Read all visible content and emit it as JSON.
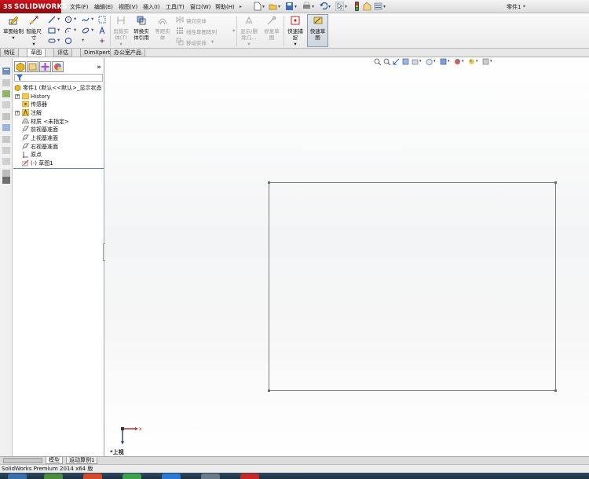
{
  "app": {
    "logo": "SOLIDWORKS",
    "document_title": "零件1 *"
  },
  "menu": {
    "items": [
      "文件(F)",
      "编辑(E)",
      "视图(V)",
      "插入(I)",
      "工具(T)",
      "窗口(W)",
      "帮助(H)"
    ]
  },
  "command_manager": {
    "sketch": "草图绘制",
    "smart_dim_1": "智能尺",
    "smart_dim_2": "寸",
    "trim_1": "剪裁实",
    "trim_2": "体(T)",
    "convert_1": "转换实",
    "convert_2": "体引用",
    "offset_1": "等距实",
    "offset_2": "体",
    "mirror": "镜向实体",
    "linear_pattern": "线性草图阵列",
    "move": "移动实体",
    "display_delete_1": "显示/删",
    "display_delete_2": "除几...",
    "repair_1": "修复草",
    "repair_2": "图",
    "quick_snap_1": "快速捕",
    "quick_snap_2": "捉",
    "rapid_sketch_1": "快速草",
    "rapid_sketch_2": "图"
  },
  "tabs": {
    "items": [
      "特征",
      "草图",
      "评估",
      "DimXpert",
      "办公室产品"
    ],
    "active_index": 1
  },
  "feature_tree": {
    "root": "零件1 (默认<<默认>_显示状态",
    "items": [
      {
        "label": "History"
      },
      {
        "label": "传感器"
      },
      {
        "label": "注解"
      },
      {
        "label": "材质 <未指定>"
      },
      {
        "label": "前视基准面"
      },
      {
        "label": "上视基准面"
      },
      {
        "label": "右视基准面"
      },
      {
        "label": "原点"
      },
      {
        "label": "(-) 草图1"
      }
    ]
  },
  "viewport": {
    "orientation_label": "*上视",
    "triad_x": "x"
  },
  "bottom_tabs": {
    "items": [
      "模型",
      "运动算例1"
    ],
    "active_index": 0
  },
  "status": {
    "text": "SolidWorks Premium 2014 x64 版"
  },
  "colors": {
    "brand_red": "#c9141a",
    "sketch_line": "#7c7c7c",
    "selection_blue": "#5b85c6"
  }
}
